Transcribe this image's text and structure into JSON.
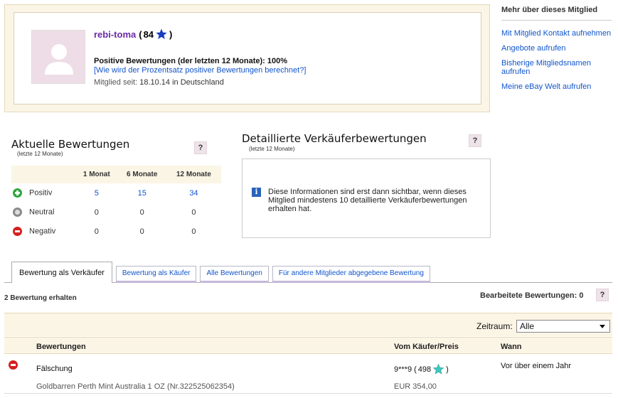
{
  "profile": {
    "username": "rebi-toma",
    "score_open": "(",
    "score": "84",
    "score_close": ")",
    "positive_label": "Positive Bewertungen (der letzten 12 Monate): 100%",
    "positive_help": "[Wie wird der Prozentsatz positiver Bewertungen berechnet?]",
    "member_since_label": "Mitglied seit:",
    "member_since_value": "18.10.14 in Deutschland"
  },
  "side": {
    "title": "Mehr über dieses Mitglied",
    "links": [
      "Mit Mitglied Kontakt aufnehmen",
      "Angebote aufrufen",
      "Bisherige Mitgliedsnamen aufrufen",
      "Meine eBay Welt aufrufen"
    ]
  },
  "current": {
    "title": "Aktuelle Bewertungen",
    "subtitle": "(letzte 12 Monate)",
    "help": "?",
    "columns": [
      "1 Monat",
      "6 Monate",
      "12 Monate"
    ],
    "rows": [
      {
        "label": "Positiv",
        "values": [
          "5",
          "15",
          "34"
        ]
      },
      {
        "label": "Neutral",
        "values": [
          "0",
          "0",
          "0"
        ]
      },
      {
        "label": "Negativ",
        "values": [
          "0",
          "0",
          "0"
        ]
      }
    ]
  },
  "detailed": {
    "title": "Detaillierte Verkäuferbewertungen",
    "subtitle": "(letzte 12 Monate)",
    "help": "?",
    "info_icon": "i",
    "info_text": "Diese Informationen sind erst dann sichtbar, wenn dieses Mitglied mindestens 10 detaillierte Verkäuferbewertungen erhalten hat."
  },
  "tabs": [
    "Bewertung als Verkäufer",
    "Bewertung als Käufer",
    "Alle Bewertungen",
    "Für andere Mitglieder abgegebene Bewertung"
  ],
  "received": "2 Bewertung erhalten",
  "edited": "Bearbeitete Bewertungen: 0",
  "edited_help": "?",
  "filter": {
    "label": "Zeitraum:",
    "selected": "Alle"
  },
  "list": {
    "headers": [
      "Bewertungen",
      "Vom Käufer/Preis",
      "Wann"
    ],
    "rows": [
      {
        "text": "Fälschung",
        "item": "Goldbarren Perth Mint Australia 1 OZ (Nr.322525062354)",
        "buyer": "9***9",
        "buyer_open": "(",
        "buyer_score": "498",
        "buyer_close": ")",
        "price": "EUR 354,00",
        "when": "Vor über einem Jahr"
      }
    ]
  },
  "colors": {
    "accent_link": "#1155cc",
    "username": "#6a2aa8",
    "positive": "#2ea63b",
    "neutral": "#8a8a8a",
    "negative": "#d42020",
    "panel_bg": "#fbf5e6"
  }
}
